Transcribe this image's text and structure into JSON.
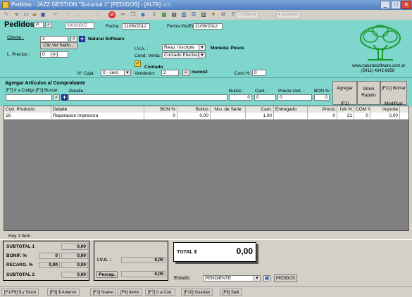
{
  "window": {
    "title": "Pedidos - JAZZ GESTION \"Sucursal 1\" [PEDIDOS] - [ALTA]",
    "title_tag": "ord"
  },
  "toolbar": {
    "btn_cliente": "Cliente",
    "btn_acciones": "Acciones"
  },
  "header": {
    "heading": "Pedidos",
    "doc_letter": "P",
    "doc_number": "00000007",
    "fecha_label": "Fecha :",
    "fecha_value": "11/06/2012",
    "fecha_vto_label": "Fecha Vto/Ent.",
    "fecha_vto_value": "11/06/2012",
    "cliente_label": "Cliente :",
    "cliente_value": "2",
    "cliente_name": "Natural Software",
    "ver_saldo": "Clic Ver Saldo...",
    "lprecios_label": "L. Precios :",
    "lprecios_value": "0",
    "iva_label": "I.V.A. :",
    "iva_value": "Resp. Inscripto",
    "moneda_label": "Moneda: Pesos",
    "cond_venta_label": "Cond. Venta:",
    "cond_venta_value": "Contado Efectivo",
    "contado_label": "Contado",
    "ncaja_label": "N° Caja:",
    "ncaja_value": "0 - cero",
    "vendedor_label": "Vendedor:",
    "vendedor_value": "2",
    "vendedor_name": "nuevo2",
    "com_label": "Com.%:",
    "com_value": "0",
    "company_url": "www.naturalsoftware.com.ar",
    "company_phone": "(5411) 4342-8858"
  },
  "articles": {
    "title": "Agregar Artículos al Comprobante",
    "hint": "[F7] Ir a Codigo [F1] Buscar",
    "detalle_label": "Detalle :",
    "bultos_label": "Bultos :",
    "bultos_value": "0",
    "cant_label": "Cant. :",
    "cant_value": "0",
    "precio_label": "Precio Unit. :",
    "precio_value": "0",
    "bon_label": "BON % :",
    "bon_value": "0",
    "agregar": "Agregar",
    "buscar": "[F1] Buscar",
    "stock": "Stock Rapido",
    "borrar": "[F11] Borrar",
    "modificar": "Modificar"
  },
  "grid": {
    "columns": [
      "Cod. Producto",
      "Detalle",
      "BON %",
      "Bultos",
      "Nro. de Serie",
      "Cant.",
      "Entregado",
      "Precio",
      "IVA %",
      "COM %",
      "Importe"
    ],
    "rows": [
      [
        "16",
        "Reparacion Impresora",
        "0",
        "0,00",
        "",
        "1,00",
        "",
        "0",
        "21",
        "0",
        "0,00"
      ]
    ]
  },
  "footer": {
    "items_count": "Hay 1 item",
    "subtotal1_label": "SUBTOTAL 1",
    "subtotal1_value": "0,00",
    "bonif_label": "BONIF. %",
    "bonif_pct": "0",
    "bonif_value": "0,00",
    "recarg_label": "RECARG. %",
    "recarg_pct": "0,00",
    "recarg_value": "0,00",
    "subtotal2_label": "SUBTOTAL 2",
    "subtotal2_value": "0,00",
    "iva_label": "I.V.A. :",
    "iva_value": "0,00",
    "percep_label": "Percep.",
    "percep_value": "0,00",
    "total_label": "TOTAL $",
    "total_value": "0,00",
    "estado_label": "Estado:",
    "estado_value": "PENDIENTE",
    "pedidos_btn": "PEDIDOS"
  },
  "statusbar": [
    "[F1/F9] $ y Stock",
    "[F3] $ Anterior",
    "[F2] Nuevo",
    "[F6] Items",
    "[F7] Ir a Cod.",
    "[F10] Guardar",
    "[F8] Salir"
  ],
  "colors": {
    "header_bg": "#7fd6cc",
    "grid_bg": "#808080",
    "title_blue": "#4f7fc0"
  }
}
